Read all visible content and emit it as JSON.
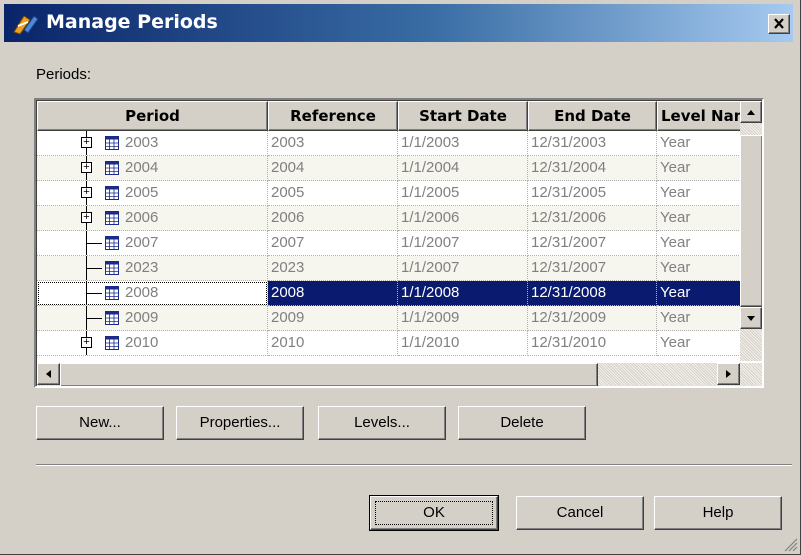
{
  "window": {
    "title": "Manage Periods",
    "title_icon": "app-calendar-icon",
    "close_icon": "close-icon"
  },
  "periods_label": "Periods:",
  "grid": {
    "columns": [
      "Period",
      "Reference",
      "Start Date",
      "End Date",
      "Level Nam"
    ],
    "rows": [
      {
        "period": "2003",
        "reference": "2003",
        "start": "1/1/2003",
        "end": "12/31/2003",
        "level": "Year",
        "expandable": true,
        "selected": false
      },
      {
        "period": "2004",
        "reference": "2004",
        "start": "1/1/2004",
        "end": "12/31/2004",
        "level": "Year",
        "expandable": true,
        "selected": false
      },
      {
        "period": "2005",
        "reference": "2005",
        "start": "1/1/2005",
        "end": "12/31/2005",
        "level": "Year",
        "expandable": true,
        "selected": false
      },
      {
        "period": "2006",
        "reference": "2006",
        "start": "1/1/2006",
        "end": "12/31/2006",
        "level": "Year",
        "expandable": true,
        "selected": false
      },
      {
        "period": "2007",
        "reference": "2007",
        "start": "1/1/2007",
        "end": "12/31/2007",
        "level": "Year",
        "expandable": false,
        "selected": false
      },
      {
        "period": "2023",
        "reference": "2023",
        "start": "1/1/2007",
        "end": "12/31/2007",
        "level": "Year",
        "expandable": false,
        "selected": false
      },
      {
        "period": "2008",
        "reference": "2008",
        "start": "1/1/2008",
        "end": "12/31/2008",
        "level": "Year",
        "expandable": false,
        "selected": true
      },
      {
        "period": "2009",
        "reference": "2009",
        "start": "1/1/2009",
        "end": "12/31/2009",
        "level": "Year",
        "expandable": false,
        "selected": false
      },
      {
        "period": "2010",
        "reference": "2010",
        "start": "1/1/2010",
        "end": "12/31/2010",
        "level": "Year",
        "expandable": true,
        "selected": false
      }
    ],
    "selected_color": "#0a1a6e",
    "alt_row_color": "#f6f5ee",
    "row_icon": "calendar-grid-icon"
  },
  "actions": {
    "new": "New...",
    "properties": "Properties...",
    "levels": "Levels...",
    "delete": "Delete"
  },
  "footer": {
    "ok": "OK",
    "cancel": "Cancel",
    "help": "Help"
  },
  "colors": {
    "titlebar_start": "#0a246a",
    "titlebar_end": "#a6caf0",
    "face": "#d4d0c8"
  }
}
